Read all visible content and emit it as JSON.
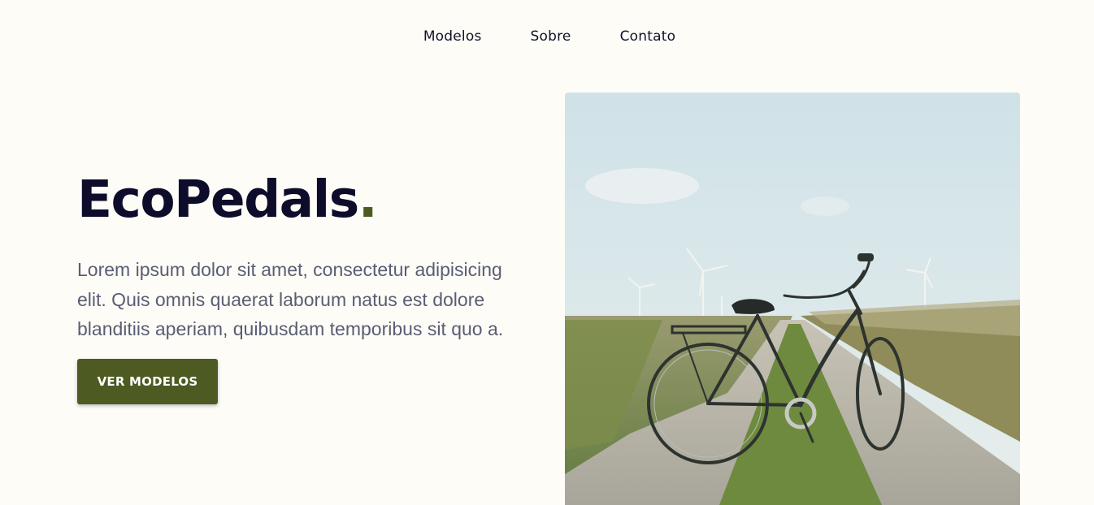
{
  "nav": {
    "items": [
      {
        "label": "Modelos"
      },
      {
        "label": "Sobre"
      },
      {
        "label": "Contato"
      }
    ]
  },
  "hero": {
    "title": "EcoPedals",
    "title_dot": ".",
    "description": "Lorem ipsum dolor sit amet, consectetur adipisicing elit. Quis omnis quaerat laborum natus est dolore blanditiis aperiam, quibusdam temporibus sit quo a.",
    "cta_label": "VER MODELOS",
    "image_subject": "bicycle-on-country-path"
  },
  "colors": {
    "background": "#fdfcf7",
    "heading": "#0d0c2b",
    "accent": "#4d5a22",
    "body_text": "#5a5d73"
  }
}
